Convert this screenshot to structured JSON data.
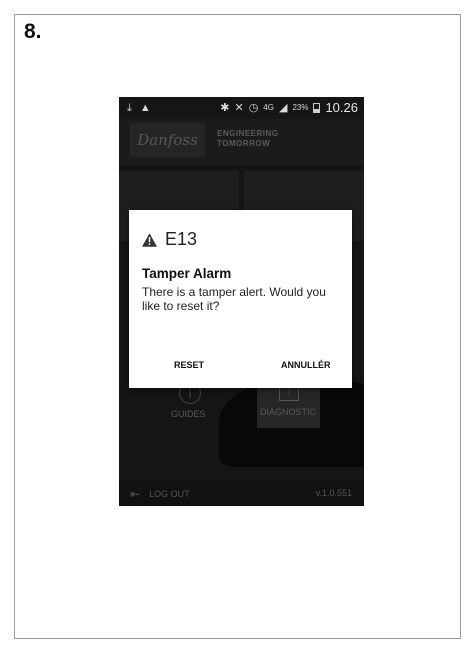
{
  "step_label": "8.",
  "status_bar": {
    "download_icon": "download-icon",
    "warning_icon": "warning-icon",
    "bluetooth_icon": "bluetooth-icon",
    "mute_icon": "mute-icon",
    "alarm_icon": "alarm-clock-icon",
    "network": "4G",
    "battery_percent": "23%",
    "time": "10.26"
  },
  "app": {
    "logo_text": "Danfoss",
    "tagline_line1": "ENGINEERING",
    "tagline_line2": "TOMORROW",
    "tiles": {
      "guides": "GUIDES",
      "diagnostic": "DIAGNOSTIC"
    },
    "footer": {
      "logout": "LOG OUT",
      "version": "v.1.0.551"
    }
  },
  "dialog": {
    "code": "E13",
    "title": "Tamper Alarm",
    "message": "There is a tamper alert. Would you like to reset it?",
    "reset_button": "RESET",
    "cancel_button": "ANNULLÉR"
  },
  "colors": {
    "phone_background": "#151515",
    "dialog_background": "#ffffff",
    "warning_icon": "#333333"
  }
}
